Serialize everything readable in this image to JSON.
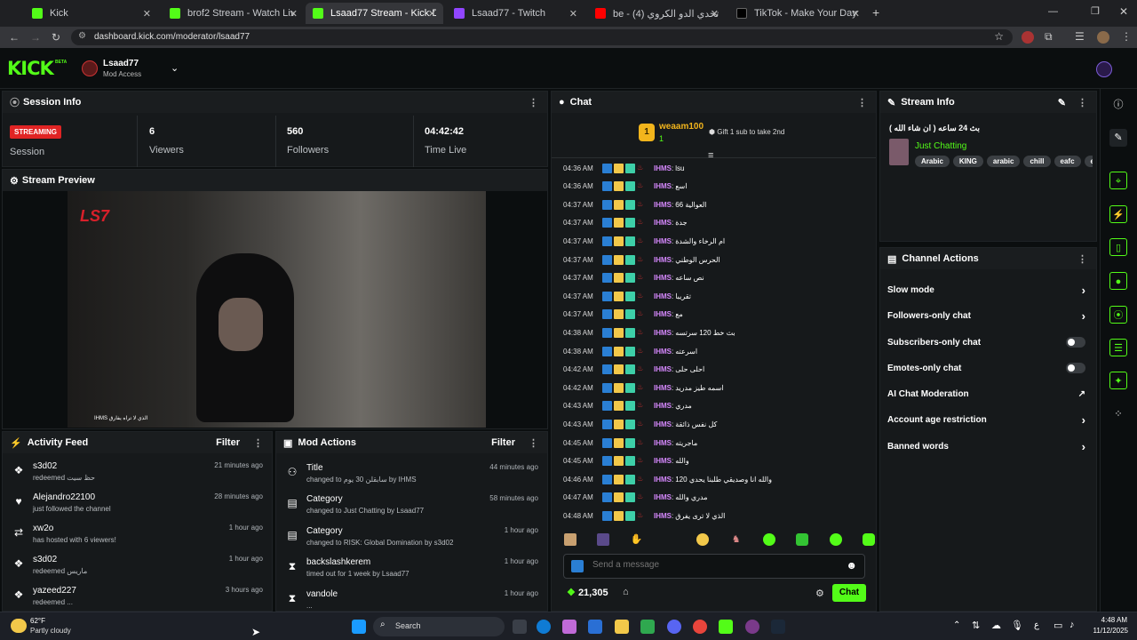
{
  "browser": {
    "tabs": [
      {
        "title": "Kick",
        "color": "#53fc18"
      },
      {
        "title": "brof2 Stream - Watch Live on Ki",
        "color": "#53fc18"
      },
      {
        "title": "Lsaad77 Stream - Kick Dashboa",
        "color": "#53fc18"
      },
      {
        "title": "Lsaad77 - Twitch",
        "color": "#9146ff"
      },
      {
        "title": "be - (4) تحدي الدو الكروي",
        "color": "#ff0000"
      },
      {
        "title": "TikTok - Make Your Day",
        "color": "#111111"
      }
    ],
    "url": "dashboard.kick.com/moderator/lsaad77"
  },
  "header": {
    "logo": "KICK",
    "beta": "BETA",
    "channel": "Lsaad77",
    "access": "Mod Access"
  },
  "session": {
    "title": "Session Info",
    "badge": "STREAMING",
    "badge_label": "Session",
    "viewers": "6",
    "viewers_label": "Viewers",
    "followers": "560",
    "followers_label": "Followers",
    "time": "04:42:42",
    "time_label": "Time Live"
  },
  "preview": {
    "title": "Stream Preview",
    "overlay": "LS7",
    "caption": "IHMS الذي لا تراه يفارق"
  },
  "activity": {
    "title": "Activity Feed",
    "filter": "Filter",
    "items": [
      {
        "icon": "coin-icon",
        "name": "s3d02",
        "sub": "redeemed حظ سيت",
        "time": "21 minutes ago"
      },
      {
        "icon": "heart-icon",
        "name": "Alejandro22100",
        "sub": "just followed the channel",
        "time": "28 minutes ago"
      },
      {
        "icon": "host-icon",
        "name": "xw2o",
        "sub": "has hosted with 6 viewers!",
        "time": "1 hour ago"
      },
      {
        "icon": "coin-icon",
        "name": "s3d02",
        "sub": "redeemed ماريس",
        "time": "1 hour ago"
      },
      {
        "icon": "coin-icon",
        "name": "yazeed227",
        "sub": "redeemed ...",
        "time": "3 hours ago"
      }
    ]
  },
  "modactions": {
    "title": "Mod Actions",
    "filter": "Filter",
    "items": [
      {
        "name": "Title",
        "sub": "changed to سابقلن 30 يوم by IHMS",
        "time": "44 minutes ago"
      },
      {
        "name": "Category",
        "sub": "changed to Just Chatting by Lsaad77",
        "time": "58 minutes ago"
      },
      {
        "name": "Category",
        "sub": "changed to RISK: Global Domination by s3d02",
        "time": "1 hour ago"
      },
      {
        "name": "backslashkerem",
        "sub": "timed out for 1 week by Lsaad77",
        "time": "1 hour ago"
      },
      {
        "name": "vandole",
        "sub": "...",
        "time": "1 hour ago"
      }
    ]
  },
  "chat": {
    "title": "Chat",
    "gifter": "weaam100",
    "gifter_count": "1",
    "gift_text": "Gift 1 sub to take 2nd",
    "messages": [
      {
        "time": "04:36 AM",
        "user": "IHMS",
        "text": "lsu"
      },
      {
        "time": "04:36 AM",
        "user": "IHMS",
        "text": "اسع"
      },
      {
        "time": "04:37 AM",
        "user": "IHMS",
        "text": "66 العوالية"
      },
      {
        "time": "04:37 AM",
        "user": "IHMS",
        "text": "جدة"
      },
      {
        "time": "04:37 AM",
        "user": "IHMS",
        "text": "ام الرخاء والشدة"
      },
      {
        "time": "04:37 AM",
        "user": "IHMS",
        "text": "الحرس الوطني"
      },
      {
        "time": "04:37 AM",
        "user": "IHMS",
        "text": "نص ساعه"
      },
      {
        "time": "04:37 AM",
        "user": "IHMS",
        "text": "تقريبا"
      },
      {
        "time": "04:37 AM",
        "user": "IHMS",
        "text": "مع"
      },
      {
        "time": "04:38 AM",
        "user": "IHMS",
        "text": "بث خط 120 سرتسه"
      },
      {
        "time": "04:38 AM",
        "user": "IHMS",
        "text": "اسرعته"
      },
      {
        "time": "04:42 AM",
        "user": "IHMS",
        "text": "احلى حلى"
      },
      {
        "time": "04:42 AM",
        "user": "IHMS",
        "text": "اسمه طيز مدريد"
      },
      {
        "time": "04:43 AM",
        "user": "IHMS",
        "text": "مدري"
      },
      {
        "time": "04:43 AM",
        "user": "IHMS",
        "text": "كل نفس ذائقة"
      },
      {
        "time": "04:45 AM",
        "user": "IHMS",
        "text": "ماجريته"
      },
      {
        "time": "04:45 AM",
        "user": "IHMS",
        "text": "والله"
      },
      {
        "time": "04:46 AM",
        "user": "IHMS",
        "text": "والله انا وصديقي طلبنا يحدي 120"
      },
      {
        "time": "04:47 AM",
        "user": "IHMS",
        "text": "مدري والله"
      },
      {
        "time": "04:48 AM",
        "user": "IHMS",
        "text": "الذي لا ترى يفرق"
      }
    ],
    "placeholder": "Send a message",
    "balance": "21,305",
    "send": "Chat"
  },
  "streaminfo": {
    "title": "Stream Info",
    "stream_title": "بث 24 ساعه ( ان شاء الله )",
    "category": "Just Chatting",
    "tags": [
      "Arabic",
      "KING",
      "arabic",
      "chill",
      "eafc",
      "ea"
    ]
  },
  "channelactions": {
    "title": "Channel Actions",
    "items": [
      {
        "label": "Slow mode",
        "kind": "chevron"
      },
      {
        "label": "Followers-only chat",
        "kind": "chevron"
      },
      {
        "label": "Subscribers-only chat",
        "kind": "toggle"
      },
      {
        "label": "Emotes-only chat",
        "kind": "toggle"
      },
      {
        "label": "AI Chat Moderation",
        "kind": "external"
      },
      {
        "label": "Account age restriction",
        "kind": "chevron"
      },
      {
        "label": "Banned words",
        "kind": "chevron"
      }
    ]
  },
  "taskbar": {
    "weather_temp": "62°F",
    "weather_desc": "Partly cloudy",
    "search": "Search",
    "time": "4:48 AM",
    "date": "11/12/2025"
  }
}
